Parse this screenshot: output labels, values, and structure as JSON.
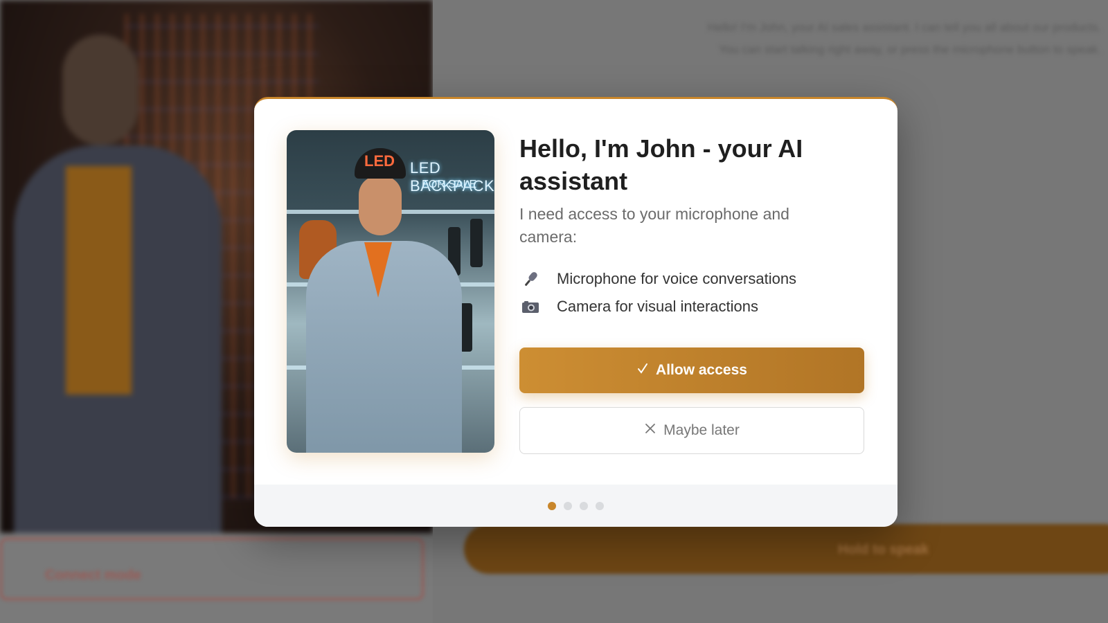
{
  "background": {
    "intro_text_line1": "Hello! I'm John, your AI sales assistant. I can tell you all about our products.",
    "intro_text_line2": "You can start talking right away, or press the microphone button to speak.",
    "connect_button_label": "Connect mode",
    "hold_button_label": "Hold to speak"
  },
  "modal": {
    "accent_color": "#c8862b",
    "hero_image": {
      "description_icon": "ai-assistant-portrait",
      "cap_text": "LED",
      "sign_line1": "LED BACKPACKS",
      "sign_line2": "FOR SALE"
    },
    "title": "Hello, I'm John - your AI assistant",
    "subtitle": "I need access to your microphone and camera:",
    "permissions": [
      {
        "icon": "microphone-icon",
        "label": "Microphone for voice conversations"
      },
      {
        "icon": "camera-icon",
        "label": "Camera for visual interactions"
      }
    ],
    "allow_button": {
      "icon": "check-icon",
      "label": "Allow access"
    },
    "later_button": {
      "icon": "close-icon",
      "label": "Maybe later"
    },
    "pagination": {
      "total": 4,
      "current": 1
    }
  }
}
